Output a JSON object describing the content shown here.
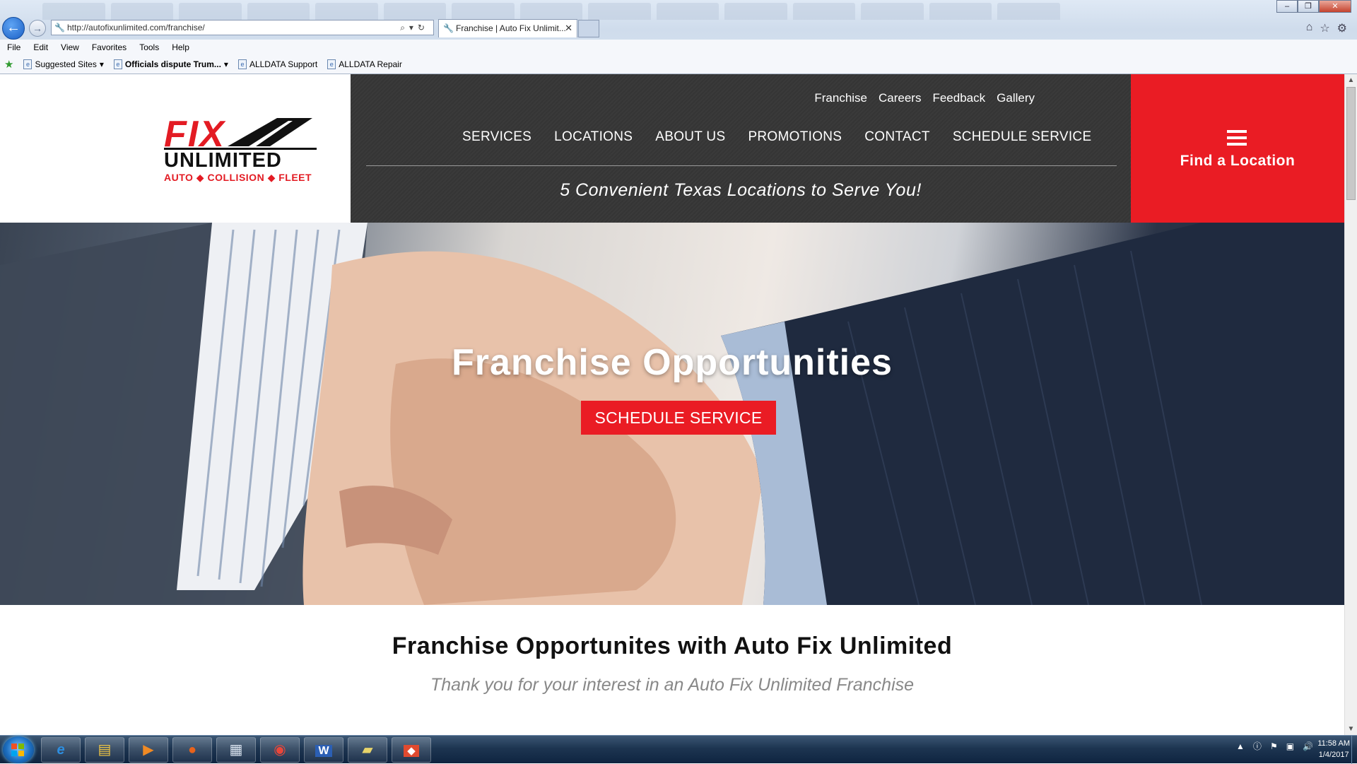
{
  "browser": {
    "address_url": "http://autofixunlimited.com/franchise/",
    "active_tab_title": "Franchise | Auto Fix Unlimit...",
    "menu": [
      "File",
      "Edit",
      "View",
      "Favorites",
      "Tools",
      "Help"
    ],
    "favorites": [
      {
        "label": "Suggested Sites",
        "dropdown": true,
        "bold": false
      },
      {
        "label": "Officials dispute Trum...",
        "dropdown": true,
        "bold": true
      },
      {
        "label": "ALLDATA Support",
        "dropdown": false,
        "bold": false
      },
      {
        "label": "ALLDATA Repair",
        "dropdown": false,
        "bold": false
      }
    ],
    "window_buttons": {
      "minimize": "–",
      "restore": "❐",
      "close": "✕"
    }
  },
  "site": {
    "logo": {
      "brand_top": "FIX",
      "brand_middle": "UNLIMITED",
      "brand_sub": "AUTO ◆ COLLISION ◆ FLEET"
    },
    "top_links": [
      "Franchise",
      "Careers",
      "Feedback",
      "Gallery"
    ],
    "main_nav": [
      "SERVICES",
      "LOCATIONS",
      "ABOUT US",
      "PROMOTIONS",
      "CONTACT",
      "SCHEDULE SERVICE"
    ],
    "tagline": "5 Convenient Texas Locations to Serve You!",
    "find_location": "Find a Location",
    "hero": {
      "title": "Franchise Opportunities",
      "button": "SCHEDULE SERVICE"
    },
    "intro": {
      "title": "Franchise Opportunites with Auto Fix Unlimited",
      "subtitle": "Thank you for your interest in an Auto Fix Unlimited Franchise"
    }
  },
  "taskbar": {
    "apps": [
      "internet-explorer",
      "file-explorer",
      "media-player",
      "firefox",
      "calculator",
      "chrome",
      "word",
      "folder-share",
      "git"
    ],
    "clock_time": "11:58 AM",
    "clock_date": "1/4/2017"
  },
  "colors": {
    "brand_red": "#ea1c24",
    "nav_dark": "#3a3a3a"
  }
}
